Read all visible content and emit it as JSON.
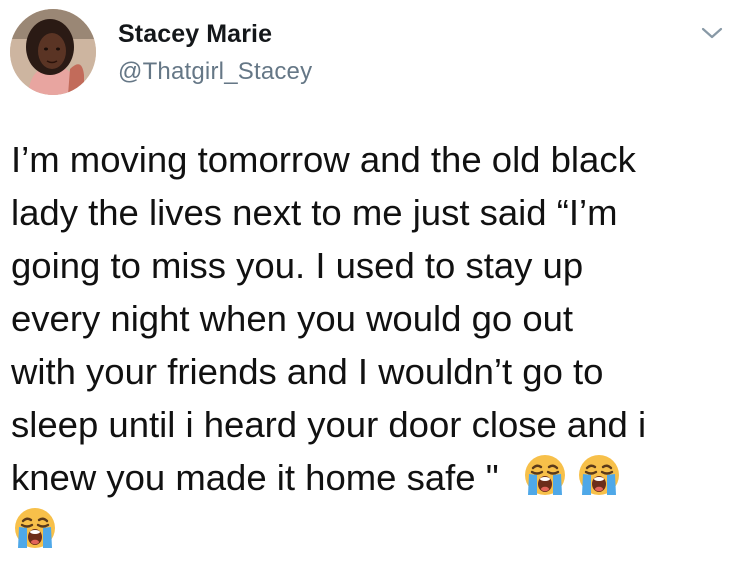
{
  "author": {
    "display_name": "Stacey Marie",
    "handle": "@Thatgirl_Stacey",
    "avatar_icon": "profile-photo"
  },
  "menu": {
    "icon": "chevron-down-icon"
  },
  "tweet": {
    "lines": [
      "I’m moving tomorrow and the old black",
      "lady the lives next to me just said “I’m",
      "going to miss you. I used to stay up",
      "every night when you would go out",
      "with your friends and I wouldn’t go to",
      "sleep until i heard your door close and i",
      "knew you made it home safe \""
    ],
    "emojis": [
      "loudly-crying-face",
      "loudly-crying-face",
      "loudly-crying-face"
    ]
  },
  "colors": {
    "name": "#14171a",
    "handle": "#657786",
    "text": "#111111",
    "emoji_face": "#f7c04a",
    "emoji_tears": "#4fa8e8"
  }
}
